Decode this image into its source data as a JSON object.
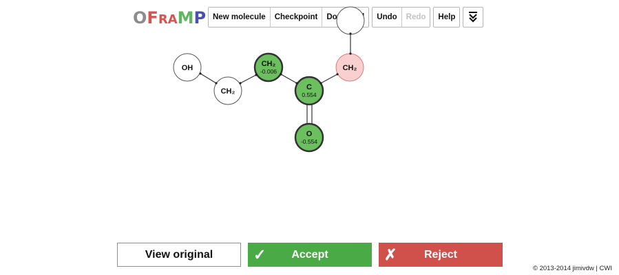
{
  "logo": {
    "o": "O",
    "F": "F",
    "r": "R",
    "a": "A",
    "M": "M",
    "P": "P",
    "colors": {
      "o": "#8c8c8c",
      "F": "#d9534f",
      "r": "#d9534f",
      "a": "#d9534f",
      "M": "#5cb85c",
      "P": "#4a50b0"
    }
  },
  "toolbar": {
    "group1": [
      "New molecule",
      "Checkpoint",
      "Download"
    ],
    "group2": [
      {
        "label": "Undo",
        "enabled": true
      },
      {
        "label": "Redo",
        "enabled": false
      }
    ],
    "help_label": "Help",
    "menu_icon": "double-chevron-down-icon"
  },
  "molecule": {
    "atoms": [
      {
        "id": "OH",
        "label": "OH",
        "charge": "",
        "state": "plain"
      },
      {
        "id": "CH2a",
        "label": "CH₂",
        "charge": "",
        "state": "plain"
      },
      {
        "id": "CH2b",
        "label": "CH₂",
        "charge": "-0.006",
        "state": "selected"
      },
      {
        "id": "C",
        "label": "C",
        "charge": "0.554",
        "state": "selected"
      },
      {
        "id": "O",
        "label": "O",
        "charge": "-0.554",
        "state": "selected"
      },
      {
        "id": "CH2c",
        "label": "CH₂",
        "charge": "",
        "state": "highlighted"
      },
      {
        "id": "top",
        "label": "",
        "charge": "",
        "state": "plain"
      }
    ],
    "colors": {
      "selected": "#6cbf5f",
      "highlighted": "#f8d0d0",
      "plain": "#ffffff"
    }
  },
  "actions": {
    "view_original": "View original",
    "accept": "Accept",
    "reject": "Reject",
    "accept_glyph": "✓",
    "reject_glyph": "✗"
  },
  "footer": "© 2013-2014 jimivdw | CWI"
}
